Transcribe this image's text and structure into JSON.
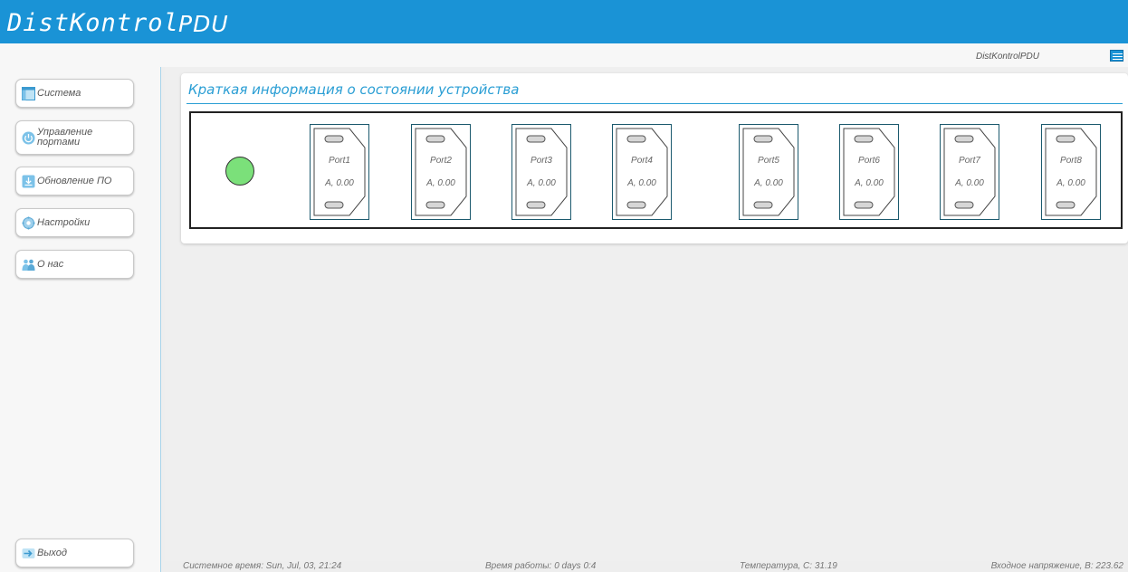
{
  "header": {
    "logo_main": "DistKontrol",
    "logo_sub": "PDU",
    "device_name": "DistKontrolPDU",
    "menu_icon": "hamburger-icon"
  },
  "sidebar": {
    "items": [
      {
        "label": "Система",
        "icon": "window-icon"
      },
      {
        "label": "Управление портами",
        "label_line1": "Управление",
        "label_line2": "портами",
        "icon": "power-icon"
      },
      {
        "label": "Обновление ПО",
        "icon": "download-icon"
      },
      {
        "label": "Настройки",
        "icon": "gear-icon"
      },
      {
        "label": "О нас",
        "icon": "people-icon"
      }
    ],
    "logout": {
      "label": "Выход",
      "icon": "arrow-right-icon"
    }
  },
  "panel": {
    "title": "Краткая информация о состоянии устройства",
    "status_color": "#7be07a",
    "ports": [
      {
        "name": "Port1",
        "amps": "A, 0.00"
      },
      {
        "name": "Port2",
        "amps": "A, 0.00"
      },
      {
        "name": "Port3",
        "amps": "A, 0.00"
      },
      {
        "name": "Port4",
        "amps": "A, 0.00"
      },
      {
        "name": "Port5",
        "amps": "A, 0.00"
      },
      {
        "name": "Port6",
        "amps": "A, 0.00"
      },
      {
        "name": "Port7",
        "amps": "A, 0.00"
      },
      {
        "name": "Port8",
        "amps": "A, 0.00"
      }
    ]
  },
  "footer": {
    "system_time": "Системное время: Sun, Jul, 03, 21:24",
    "uptime": "Время работы: 0 days 0:4",
    "temperature": "Температура, С: 31.19",
    "input_voltage": "Входное напряжение, В: 223.62"
  },
  "colors": {
    "accent": "#1a93d6",
    "title": "#2a9ed4"
  }
}
